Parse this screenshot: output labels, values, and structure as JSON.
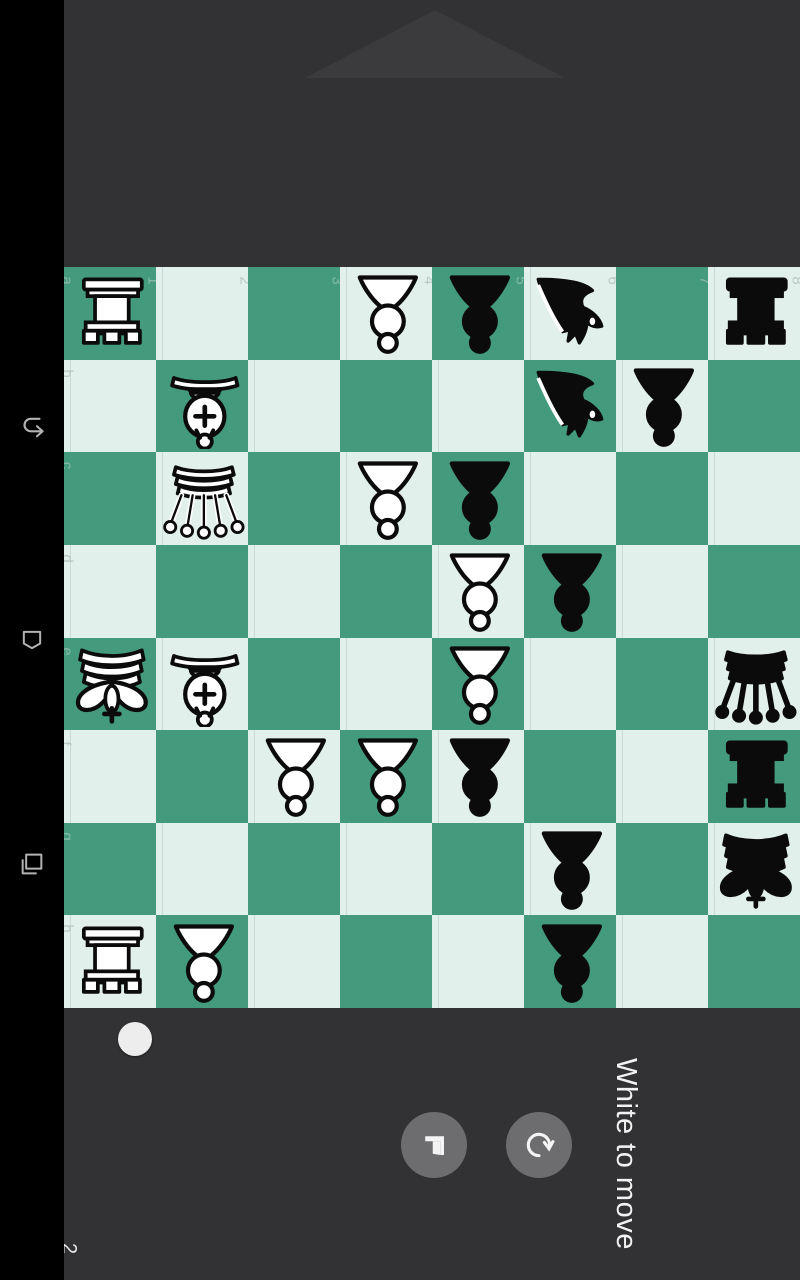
{
  "app": {
    "background_color": "#323234",
    "board": {
      "light_square_color": "#e2f0ec",
      "dark_square_color": "#449a7d",
      "orientation": "rotated-90",
      "file_labels": [
        "a",
        "b",
        "c",
        "d",
        "e",
        "f",
        "g",
        "h"
      ],
      "rank_labels": [
        "1",
        "2",
        "3",
        "4",
        "5",
        "6",
        "7",
        "8"
      ],
      "rows": [
        {
          "file": "a",
          "squares": [
            {
              "rank": "1",
              "color": "dark",
              "piece": "white-rook"
            },
            {
              "rank": "2",
              "color": "light",
              "piece": null
            },
            {
              "rank": "3",
              "color": "dark",
              "piece": null
            },
            {
              "rank": "4",
              "color": "light",
              "piece": "white-pawn"
            },
            {
              "rank": "5",
              "color": "dark",
              "piece": "black-pawn"
            },
            {
              "rank": "6",
              "color": "light",
              "piece": "black-knight"
            },
            {
              "rank": "7",
              "color": "dark",
              "piece": null
            },
            {
              "rank": "8",
              "color": "light",
              "piece": "black-rook"
            }
          ]
        },
        {
          "file": "b",
          "squares": [
            {
              "rank": "1",
              "color": "light",
              "piece": null
            },
            {
              "rank": "2",
              "color": "dark",
              "piece": "white-bishop"
            },
            {
              "rank": "3",
              "color": "light",
              "piece": null
            },
            {
              "rank": "4",
              "color": "dark",
              "piece": null
            },
            {
              "rank": "5",
              "color": "light",
              "piece": null
            },
            {
              "rank": "6",
              "color": "dark",
              "piece": "black-knight"
            },
            {
              "rank": "7",
              "color": "light",
              "piece": "black-pawn"
            },
            {
              "rank": "8",
              "color": "dark",
              "piece": null
            }
          ]
        },
        {
          "file": "c",
          "squares": [
            {
              "rank": "1",
              "color": "dark",
              "piece": null
            },
            {
              "rank": "2",
              "color": "light",
              "piece": "white-queen"
            },
            {
              "rank": "3",
              "color": "dark",
              "piece": null
            },
            {
              "rank": "4",
              "color": "light",
              "piece": "white-pawn"
            },
            {
              "rank": "5",
              "color": "dark",
              "piece": "black-pawn"
            },
            {
              "rank": "6",
              "color": "light",
              "piece": null
            },
            {
              "rank": "7",
              "color": "dark",
              "piece": null
            },
            {
              "rank": "8",
              "color": "light",
              "piece": null
            }
          ]
        },
        {
          "file": "d",
          "squares": [
            {
              "rank": "1",
              "color": "light",
              "piece": null
            },
            {
              "rank": "2",
              "color": "dark",
              "piece": null
            },
            {
              "rank": "3",
              "color": "light",
              "piece": null
            },
            {
              "rank": "4",
              "color": "dark",
              "piece": null
            },
            {
              "rank": "5",
              "color": "light",
              "piece": "white-pawn"
            },
            {
              "rank": "6",
              "color": "dark",
              "piece": "black-pawn"
            },
            {
              "rank": "7",
              "color": "light",
              "piece": null
            },
            {
              "rank": "8",
              "color": "dark",
              "piece": null
            }
          ]
        },
        {
          "file": "e",
          "squares": [
            {
              "rank": "1",
              "color": "dark",
              "piece": "white-king"
            },
            {
              "rank": "2",
              "color": "light",
              "piece": "white-bishop"
            },
            {
              "rank": "3",
              "color": "dark",
              "piece": null
            },
            {
              "rank": "4",
              "color": "light",
              "piece": null
            },
            {
              "rank": "5",
              "color": "dark",
              "piece": "white-pawn"
            },
            {
              "rank": "6",
              "color": "light",
              "piece": null
            },
            {
              "rank": "7",
              "color": "dark",
              "piece": null
            },
            {
              "rank": "8",
              "color": "light",
              "piece": "black-queen"
            }
          ]
        },
        {
          "file": "f",
          "squares": [
            {
              "rank": "1",
              "color": "light",
              "piece": null
            },
            {
              "rank": "2",
              "color": "dark",
              "piece": null
            },
            {
              "rank": "3",
              "color": "light",
              "piece": "white-pawn"
            },
            {
              "rank": "4",
              "color": "dark",
              "piece": "white-pawn"
            },
            {
              "rank": "5",
              "color": "light",
              "piece": "black-pawn"
            },
            {
              "rank": "6",
              "color": "dark",
              "piece": null
            },
            {
              "rank": "7",
              "color": "light",
              "piece": null
            },
            {
              "rank": "8",
              "color": "dark",
              "piece": "black-rook"
            }
          ]
        },
        {
          "file": "g",
          "squares": [
            {
              "rank": "1",
              "color": "dark",
              "piece": null
            },
            {
              "rank": "2",
              "color": "light",
              "piece": null
            },
            {
              "rank": "3",
              "color": "dark",
              "piece": null
            },
            {
              "rank": "4",
              "color": "light",
              "piece": null
            },
            {
              "rank": "5",
              "color": "dark",
              "piece": null
            },
            {
              "rank": "6",
              "color": "light",
              "piece": "black-pawn"
            },
            {
              "rank": "7",
              "color": "dark",
              "piece": null
            },
            {
              "rank": "8",
              "color": "light",
              "piece": "black-king"
            }
          ]
        },
        {
          "file": "h",
          "squares": [
            {
              "rank": "1",
              "color": "light",
              "piece": "white-rook"
            },
            {
              "rank": "2",
              "color": "dark",
              "piece": "white-pawn"
            },
            {
              "rank": "3",
              "color": "light",
              "piece": null
            },
            {
              "rank": "4",
              "color": "dark",
              "piece": null
            },
            {
              "rank": "5",
              "color": "light",
              "piece": null
            },
            {
              "rank": "6",
              "color": "dark",
              "piece": "black-pawn"
            },
            {
              "rank": "7",
              "color": "light",
              "piece": null
            },
            {
              "rank": "8",
              "color": "dark",
              "piece": null
            }
          ]
        }
      ]
    },
    "status": {
      "text": "White to move",
      "turn_indicator_color": "#ededed",
      "move_number": "2"
    },
    "controls": [
      {
        "name": "flag-button",
        "icon": "flag-icon",
        "label": ""
      },
      {
        "name": "undo-button",
        "icon": "undo-icon",
        "label": ""
      }
    ],
    "system_nav": [
      {
        "name": "back-button",
        "icon": "back-arrow-icon"
      },
      {
        "name": "home-button",
        "icon": "home-icon"
      },
      {
        "name": "recents-button",
        "icon": "recents-icon"
      }
    ]
  }
}
